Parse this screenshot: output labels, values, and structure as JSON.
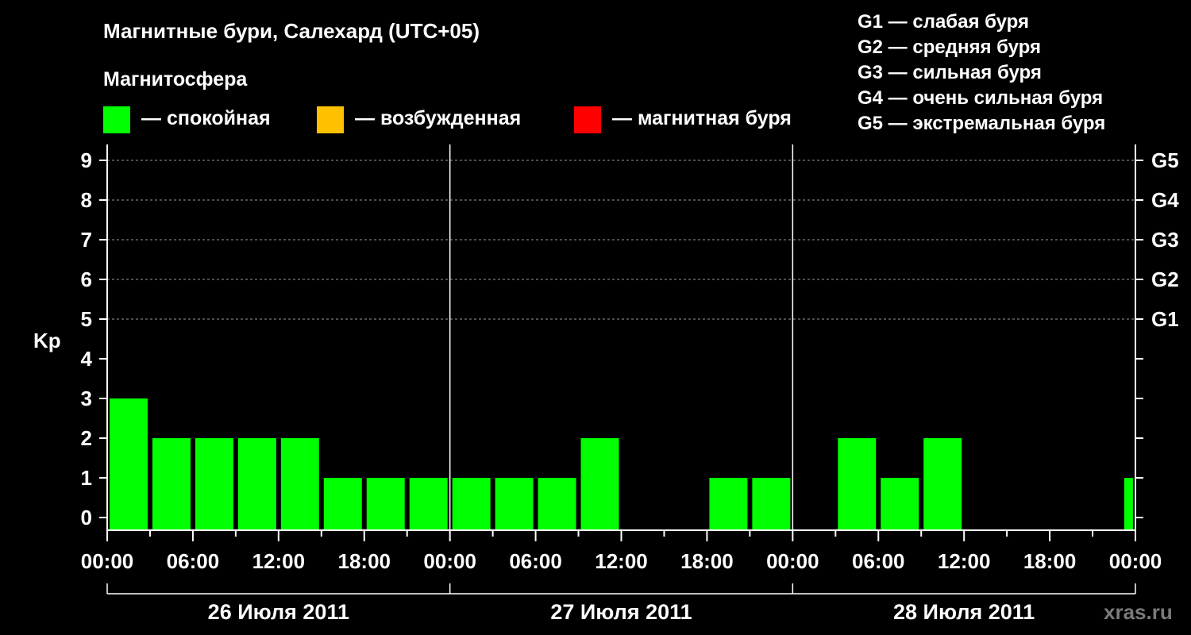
{
  "header": {
    "title": "Магнитные бури, Салехард (UTC+05)",
    "subtitle": "Магнитосфера"
  },
  "legend": {
    "items": [
      {
        "label": "— спокойная",
        "color": "#00ff00"
      },
      {
        "label": "— возбужденная",
        "color": "#ffc000"
      },
      {
        "label": "— магнитная буря",
        "color": "#ff0000"
      }
    ]
  },
  "storm_scale": [
    "G1 — слабая буря",
    "G2 — средняя буря",
    "G3 — сильная буря",
    "G4 — очень сильная буря",
    "G5 — экстремальная буря"
  ],
  "watermark": "xras.ru",
  "chart_data": {
    "type": "bar",
    "ylabel": "Kp",
    "ylim": [
      0,
      9
    ],
    "yticks": [
      0,
      1,
      2,
      3,
      4,
      5,
      6,
      7,
      8,
      9
    ],
    "right_ticks": [
      {
        "value": 5,
        "label": "G1"
      },
      {
        "value": 6,
        "label": "G2"
      },
      {
        "value": 7,
        "label": "G3"
      },
      {
        "value": 8,
        "label": "G4"
      },
      {
        "value": 9,
        "label": "G5"
      }
    ],
    "grid": "dashed horizontal at 5-9",
    "x_tick_labels": [
      "00:00",
      "06:00",
      "12:00",
      "18:00",
      "00:00",
      "06:00",
      "12:00",
      "18:00",
      "00:00",
      "06:00",
      "12:00",
      "18:00",
      "00:00"
    ],
    "days": [
      "26 Июля 2011",
      "27 Июля 2011",
      "28 Июля 2011"
    ],
    "interval_hours": 3,
    "categories": [
      "26 Июля 2011 00:00",
      "26 Июля 2011 03:00",
      "26 Июля 2011 06:00",
      "26 Июля 2011 09:00",
      "26 Июля 2011 12:00",
      "26 Июля 2011 15:00",
      "26 Июля 2011 18:00",
      "26 Июля 2011 21:00",
      "27 Июля 2011 00:00",
      "27 Июля 2011 03:00",
      "27 Июля 2011 06:00",
      "27 Июля 2011 09:00",
      "27 Июля 2011 12:00",
      "27 Июля 2011 15:00",
      "27 Июля 2011 18:00",
      "27 Июля 2011 21:00",
      "28 Июля 2011 00:00",
      "28 Июля 2011 03:00",
      "28 Июля 2011 06:00",
      "28 Июля 2011 09:00",
      "28 Июля 2011 12:00",
      "28 Июля 2011 15:00",
      "28 Июля 2011 18:00",
      "28 Июля 2011 21:00"
    ],
    "values": [
      3,
      2,
      2,
      2,
      2,
      1,
      1,
      1,
      1,
      1,
      1,
      2,
      0,
      0,
      1,
      1,
      0,
      2,
      1,
      2,
      0,
      0,
      0,
      0
    ],
    "bar_color": "#00ff00",
    "trailing_bar": {
      "time": "28 Июля 2011 24:00",
      "value": 1
    }
  }
}
